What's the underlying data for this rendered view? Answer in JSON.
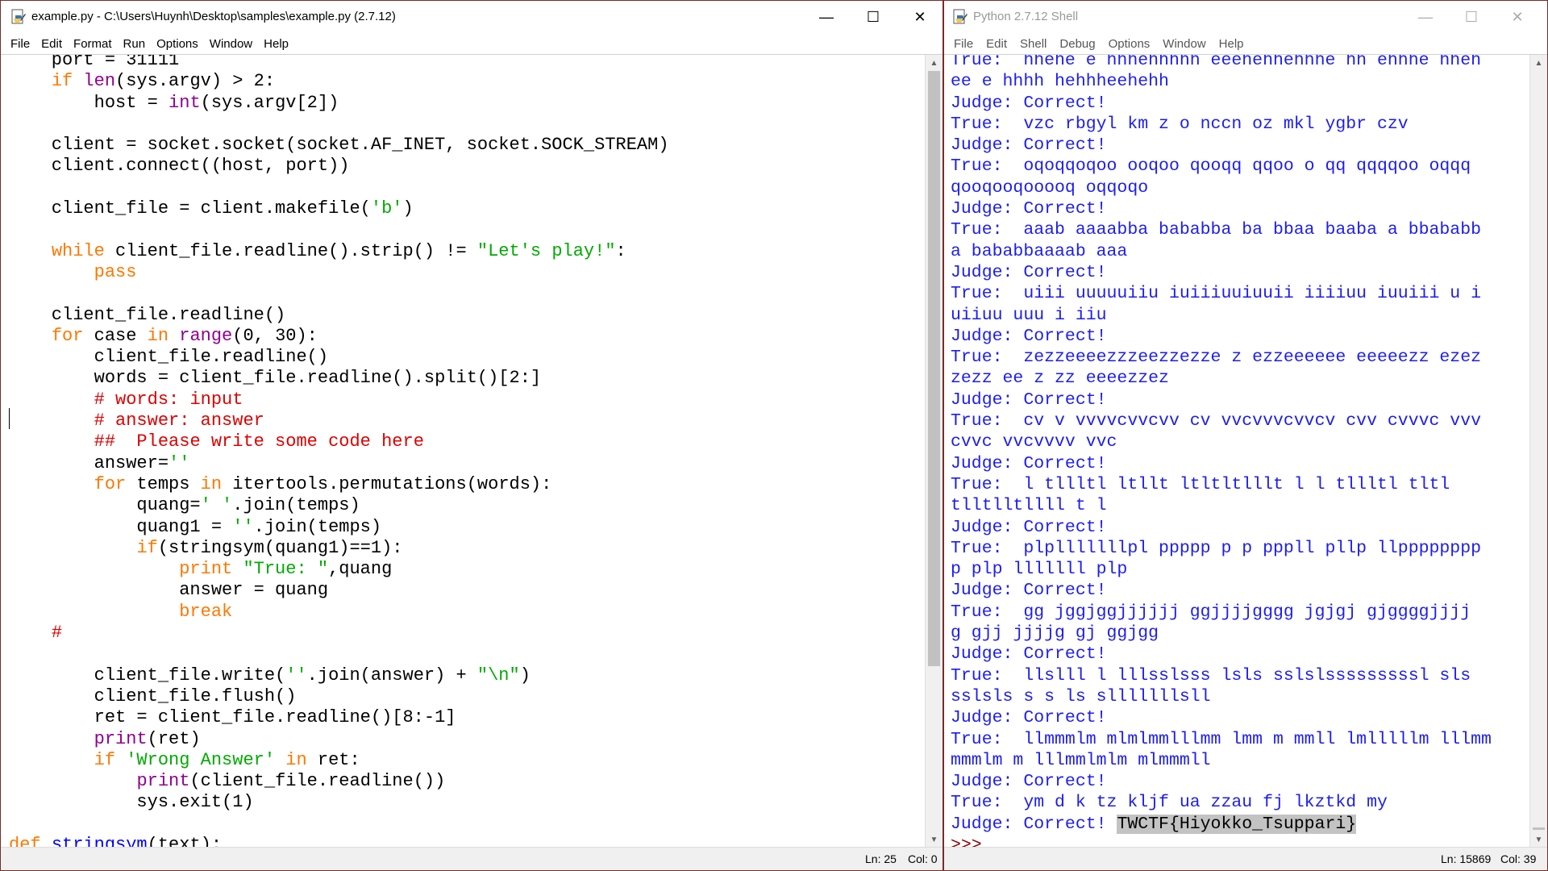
{
  "editor": {
    "title": "example.py - C:\\Users\\Huynh\\Desktop\\samples\\example.py (2.7.12)",
    "menu": [
      "File",
      "Edit",
      "Format",
      "Run",
      "Options",
      "Window",
      "Help"
    ],
    "status": {
      "line": "Ln: 25",
      "col": "Col: 0"
    },
    "code": [
      [
        {
          "t": "    port = 31111",
          "c": ""
        }
      ],
      [
        {
          "t": "    ",
          "c": ""
        },
        {
          "t": "if",
          "c": "kw"
        },
        {
          "t": " ",
          "c": ""
        },
        {
          "t": "len",
          "c": "bi"
        },
        {
          "t": "(sys.argv) > 2:",
          "c": ""
        }
      ],
      [
        {
          "t": "        host = ",
          "c": ""
        },
        {
          "t": "int",
          "c": "bi"
        },
        {
          "t": "(sys.argv[2])",
          "c": ""
        }
      ],
      [
        {
          "t": "",
          "c": ""
        }
      ],
      [
        {
          "t": "    client = socket.socket(socket.AF_INET, socket.SOCK_STREAM)",
          "c": ""
        }
      ],
      [
        {
          "t": "    client.connect((host, port))",
          "c": ""
        }
      ],
      [
        {
          "t": "",
          "c": ""
        }
      ],
      [
        {
          "t": "    client_file = client.makefile(",
          "c": ""
        },
        {
          "t": "'b'",
          "c": "st"
        },
        {
          "t": ")",
          "c": ""
        }
      ],
      [
        {
          "t": "",
          "c": ""
        }
      ],
      [
        {
          "t": "    ",
          "c": ""
        },
        {
          "t": "while",
          "c": "kw"
        },
        {
          "t": " client_file.readline().strip() != ",
          "c": ""
        },
        {
          "t": "\"Let's play!\"",
          "c": "st"
        },
        {
          "t": ":",
          "c": ""
        }
      ],
      [
        {
          "t": "        ",
          "c": ""
        },
        {
          "t": "pass",
          "c": "kw"
        }
      ],
      [
        {
          "t": "",
          "c": ""
        }
      ],
      [
        {
          "t": "    client_file.readline()",
          "c": ""
        }
      ],
      [
        {
          "t": "    ",
          "c": ""
        },
        {
          "t": "for",
          "c": "kw"
        },
        {
          "t": " case ",
          "c": ""
        },
        {
          "t": "in",
          "c": "kw"
        },
        {
          "t": " ",
          "c": ""
        },
        {
          "t": "range",
          "c": "bi"
        },
        {
          "t": "(0, 30):",
          "c": ""
        }
      ],
      [
        {
          "t": "        client_file.readline()",
          "c": ""
        }
      ],
      [
        {
          "t": "        words = client_file.readline().split()[2:]",
          "c": ""
        }
      ],
      [
        {
          "t": "        ",
          "c": ""
        },
        {
          "t": "# words: input",
          "c": "cm"
        }
      ],
      [
        {
          "t": "        ",
          "c": ""
        },
        {
          "t": "# answer: answer",
          "c": "cm"
        }
      ],
      [
        {
          "t": "        ",
          "c": ""
        },
        {
          "t": "##  Please write some code here",
          "c": "cm"
        }
      ],
      [
        {
          "t": "        answer=",
          "c": ""
        },
        {
          "t": "''",
          "c": "st"
        }
      ],
      [
        {
          "t": "        ",
          "c": ""
        },
        {
          "t": "for",
          "c": "kw"
        },
        {
          "t": " temps ",
          "c": ""
        },
        {
          "t": "in",
          "c": "kw"
        },
        {
          "t": " itertools.permutations(words):",
          "c": ""
        }
      ],
      [
        {
          "t": "            quang=",
          "c": ""
        },
        {
          "t": "' '",
          "c": "st"
        },
        {
          "t": ".join(temps)",
          "c": ""
        }
      ],
      [
        {
          "t": "            quang1 = ",
          "c": ""
        },
        {
          "t": "''",
          "c": "st"
        },
        {
          "t": ".join(temps)",
          "c": ""
        }
      ],
      [
        {
          "t": "            ",
          "c": ""
        },
        {
          "t": "if",
          "c": "kw"
        },
        {
          "t": "(stringsym(quang1)==1):",
          "c": ""
        }
      ],
      [
        {
          "t": "                ",
          "c": ""
        },
        {
          "t": "print",
          "c": "kw"
        },
        {
          "t": " ",
          "c": ""
        },
        {
          "t": "\"True: \"",
          "c": "st"
        },
        {
          "t": ",quang",
          "c": ""
        }
      ],
      [
        {
          "t": "                answer = quang",
          "c": ""
        }
      ],
      [
        {
          "t": "                ",
          "c": ""
        },
        {
          "t": "break",
          "c": "kw"
        }
      ],
      [
        {
          "t": "    ",
          "c": ""
        },
        {
          "t": "#",
          "c": "cm"
        }
      ],
      [
        {
          "t": "",
          "c": ""
        }
      ],
      [
        {
          "t": "        client_file.write(",
          "c": ""
        },
        {
          "t": "''",
          "c": "st"
        },
        {
          "t": ".join(answer) + ",
          "c": ""
        },
        {
          "t": "\"\\n\"",
          "c": "st"
        },
        {
          "t": ")",
          "c": ""
        }
      ],
      [
        {
          "t": "        client_file.flush()",
          "c": ""
        }
      ],
      [
        {
          "t": "        ret = client_file.readline()[8:-1]",
          "c": ""
        }
      ],
      [
        {
          "t": "        ",
          "c": ""
        },
        {
          "t": "print",
          "c": "bi"
        },
        {
          "t": "(ret)",
          "c": ""
        }
      ],
      [
        {
          "t": "        ",
          "c": ""
        },
        {
          "t": "if",
          "c": "kw"
        },
        {
          "t": " ",
          "c": ""
        },
        {
          "t": "'Wrong Answer'",
          "c": "st"
        },
        {
          "t": " ",
          "c": ""
        },
        {
          "t": "in",
          "c": "kw"
        },
        {
          "t": " ret:",
          "c": ""
        }
      ],
      [
        {
          "t": "            ",
          "c": ""
        },
        {
          "t": "print",
          "c": "bi"
        },
        {
          "t": "(client_file.readline())",
          "c": ""
        }
      ],
      [
        {
          "t": "            sys.exit(1)",
          "c": ""
        }
      ],
      [
        {
          "t": "",
          "c": ""
        }
      ],
      [
        {
          "t": "def",
          "c": "kw"
        },
        {
          "t": " ",
          "c": ""
        },
        {
          "t": "stringsym",
          "c": "df"
        },
        {
          "t": "(text):",
          "c": ""
        }
      ]
    ]
  },
  "shell": {
    "title": "Python 2.7.12 Shell",
    "menu": [
      "File",
      "Edit",
      "Shell",
      "Debug",
      "Options",
      "Window",
      "Help"
    ],
    "status": {
      "line": "Ln: 15869",
      "col": "Col: 39"
    },
    "output": [
      "True:  hhehe e hhhehhhhh eeehehhehhhe hh ehhhe hheh",
      "ee e hhhh hehhheehehh",
      "Judge: Correct!",
      "True:  vzc rbgyl km z o nccn oz mkl ygbr czv",
      "Judge: Correct!",
      "True:  oqoqqoqoo ooqoo qooqq qqoo o qq qqqqoo oqqq",
      "qooqooqooooq oqqoqo",
      "Judge: Correct!",
      "True:  aaab aaaabba bababba ba bbaa baaba a bbababb",
      "a bababbaaaab aaa",
      "Judge: Correct!",
      "True:  uiii uuuuuiiu iuiiiuuiuuii iiiiuu iuuiii u i",
      "uiiuu uuu i iiu",
      "Judge: Correct!",
      "True:  zezzeeeezzzeezzezze z ezzeeeeee eeeeezz ezez",
      "zezz ee z zz eeeezzez",
      "Judge: Correct!",
      "True:  cv v vvvvcvvcvv cv vvcvvvcvvcv cvv cvvvc vvv",
      "cvvc vvcvvvv vvc",
      "Judge: Correct!",
      "True:  l tllltl ltllt ltltltlllt l l tllltl tltl",
      "tlltlltllll t l",
      "Judge: Correct!",
      "True:  plplllllllpl ppppp p p pppll pllp llpppppppp",
      "p plp lllllll plp",
      "Judge: Correct!",
      "True:  gg jggjggjjjjjj ggjjjjgggg jgjgj gjggggjjjj",
      "g gjj jjjjg gj ggjgg",
      "Judge: Correct!",
      "True:  llslll l lllsslsss lsls sslslsssssssssl sls",
      "sslsls s s ls slllllllsll",
      "Judge: Correct!",
      "True:  llmmmlm mlmlmmlllmm lmm m mmll lmlllllm lllmm",
      "mmmlm m lllmmlmlm mlmmmll",
      "Judge: Correct!",
      "True:  ym d k tz kljf ua zzau fj lkztkd my"
    ],
    "last_judge": "Judge: Correct! ",
    "flag": "TWCTF{Hiyokko_Tsuppari}",
    "prompt": ">>>"
  }
}
